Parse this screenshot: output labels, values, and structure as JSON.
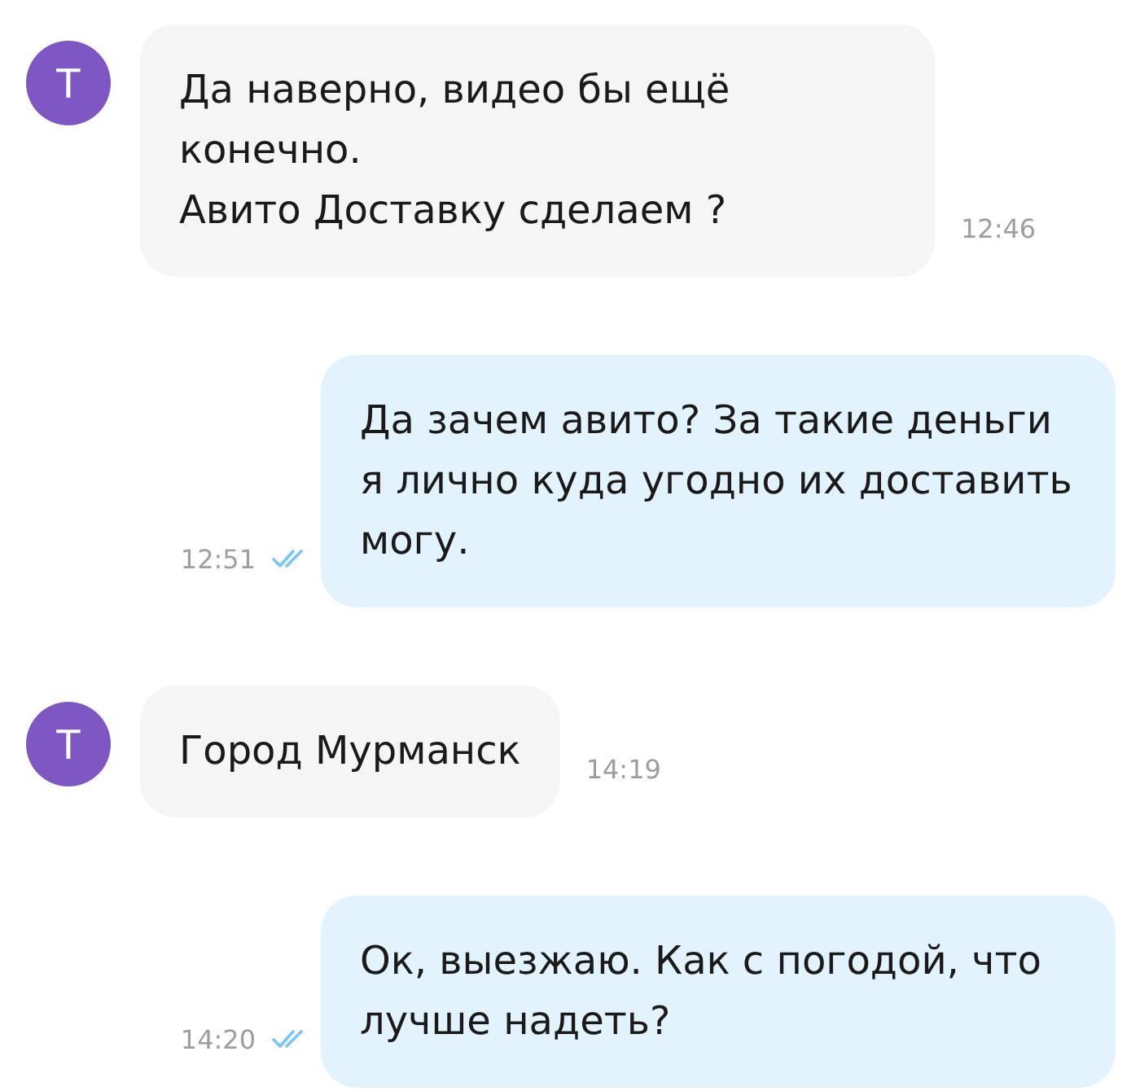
{
  "messages": [
    {
      "kind": "incoming",
      "avatar": "Т",
      "text": "Да наверно, видео бы ещё конечно.\nАвито Доставку сделаем ?",
      "time": "12:46"
    },
    {
      "kind": "outgoing",
      "text": "Да зачем авито? За такие деньги я лично куда угодно их доставить могу.",
      "time": "12:51",
      "read": true
    },
    {
      "kind": "incoming",
      "avatar": "Т",
      "text": "Город Мурманск",
      "time": "14:19"
    },
    {
      "kind": "outgoing",
      "text": "Ок, выезжаю. Как с погодой, что лучше надеть?",
      "time": "14:20",
      "read": true
    }
  ]
}
